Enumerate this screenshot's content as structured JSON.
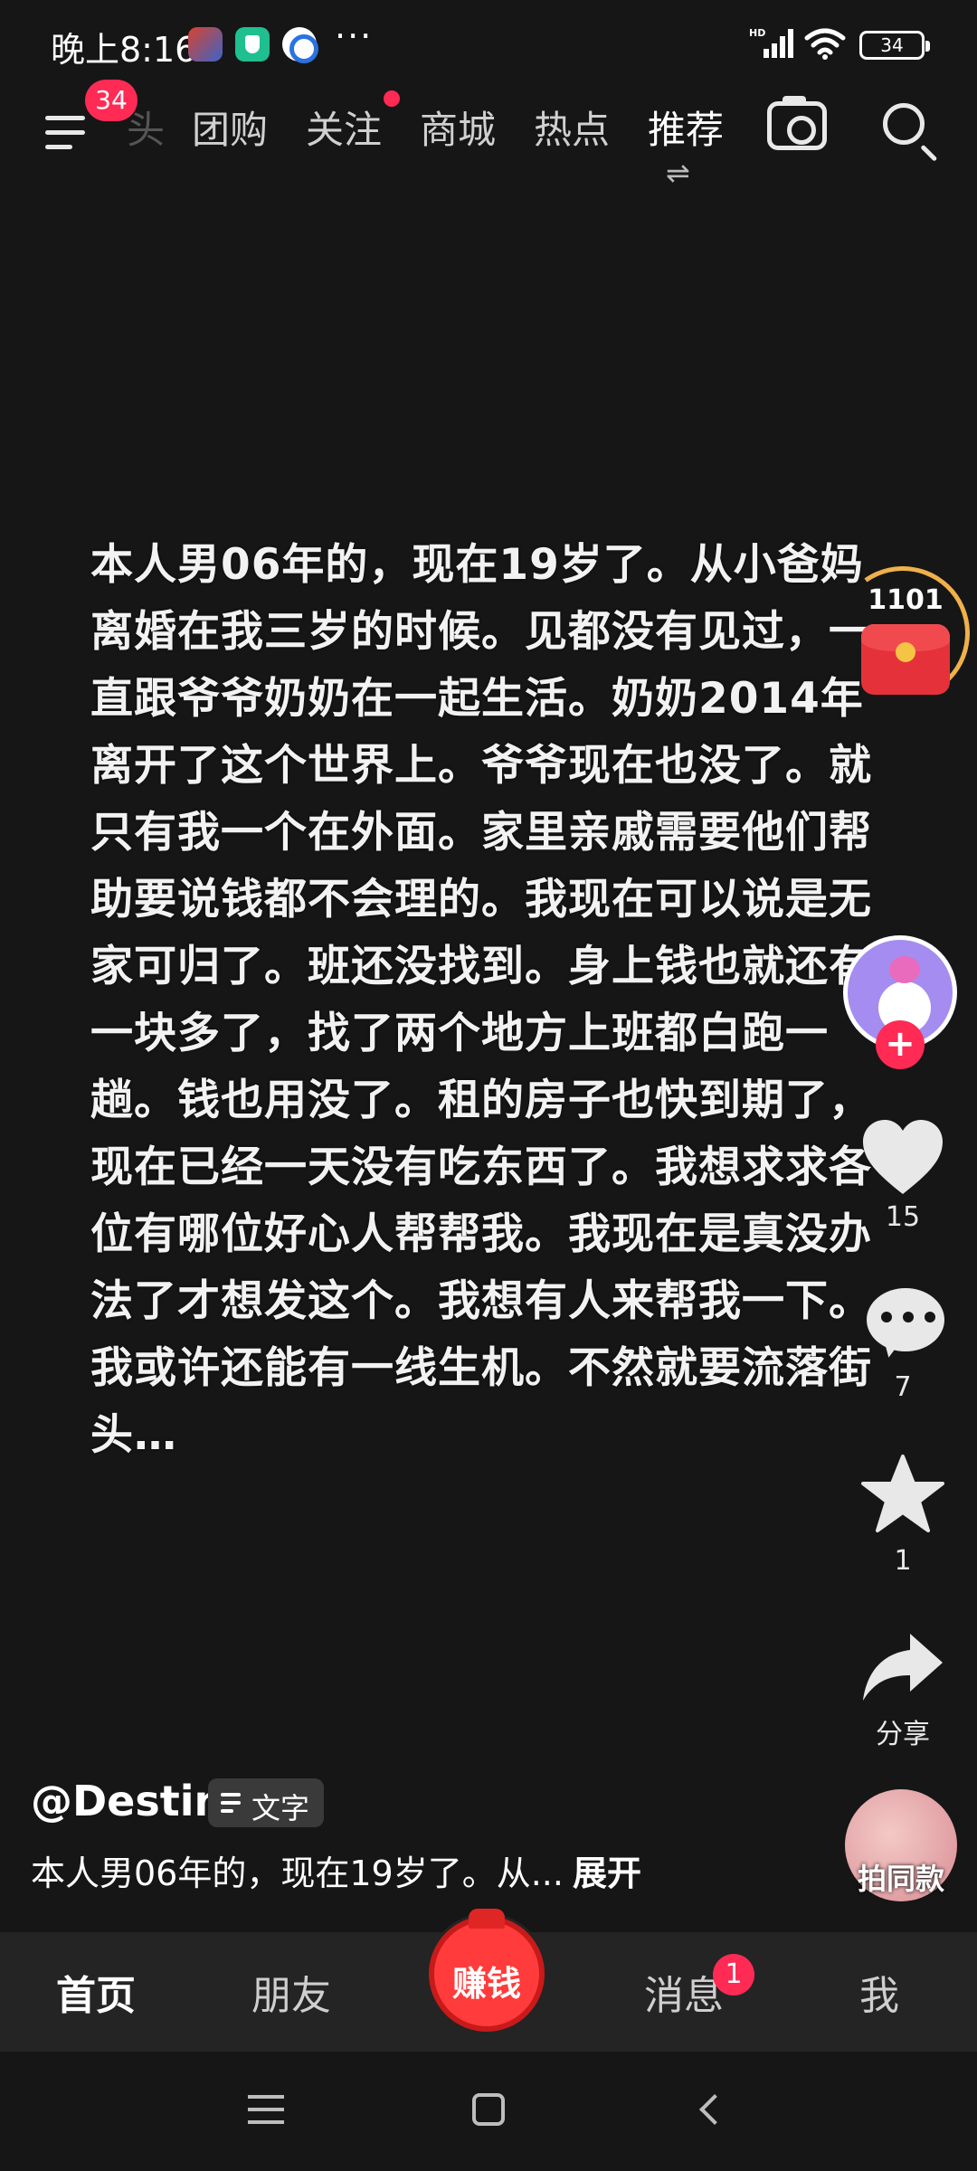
{
  "status_bar": {
    "time": "晚上8:16",
    "more": "···",
    "battery": "34",
    "icons": [
      "game-app-icon",
      "shield-app-icon",
      "browser-app-icon",
      "hd-signal-icon",
      "wifi-icon",
      "battery-icon"
    ]
  },
  "top_nav": {
    "menu_badge": "34",
    "tabs": [
      {
        "label": "头",
        "state": "faded"
      },
      {
        "label": "团购"
      },
      {
        "label": "关注",
        "has_dot": true
      },
      {
        "label": "商城"
      },
      {
        "label": "热点"
      },
      {
        "label": "推荐",
        "state": "active"
      }
    ],
    "swap_symbol": "⇌"
  },
  "post": {
    "text": "本人男06年的，现在19岁了。从小爸妈离婚在我三岁的时候。见都没有见过，一直跟爷爷奶奶在一起生活。奶奶2014年离开了这个世界上。爷爷现在也没了。就只有我一个在外面。家里亲戚需要他们帮助要说钱都不会理的。我现在可以说是无家可归了。班还没找到。身上钱也就还有一块多了，找了两个地方上班都白跑一趟。钱也用没了。租的房子也快到期了，现在已经一天没有吃东西了。我想求求各位有哪位好心人帮帮我。我现在是真没办法了才想发这个。我想有人来帮我一下。我或许还能有一线生机。不然就要流落街头…"
  },
  "right_rail": {
    "redpack_count": "1101",
    "follow_symbol": "+",
    "likes": "15",
    "comments": "7",
    "favorites": "1",
    "share_label": "分享",
    "same_style_label": "拍同款"
  },
  "author": {
    "name": "@Destin",
    "tag_label": "文字"
  },
  "caption": {
    "text": "本人男06年的，现在19岁了。从...",
    "expand_label": "展开"
  },
  "bottom_nav": {
    "home": "首页",
    "friends": "朋友",
    "earn": "赚钱",
    "messages": "消息",
    "messages_badge": "1",
    "me": "我"
  },
  "colors": {
    "background": "#161616",
    "badge_red": "#ff2b55",
    "bottom_bar": "#242424",
    "redpack_ring": "#f0b04a"
  }
}
